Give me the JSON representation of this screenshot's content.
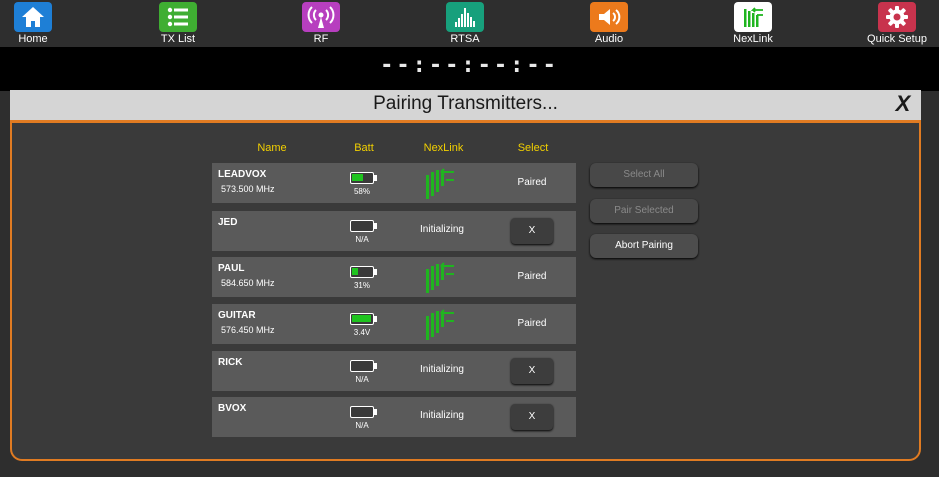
{
  "nav": [
    {
      "label": "Home",
      "icon": "home-icon",
      "color": "#1e7fd6"
    },
    {
      "label": "TX List",
      "icon": "list-icon",
      "color": "#3fae32"
    },
    {
      "label": "RF",
      "icon": "antenna-icon",
      "color": "#b73fbf"
    },
    {
      "label": "RTSA",
      "icon": "spectrum-icon",
      "color": "#17a07c"
    },
    {
      "label": "Audio",
      "icon": "speaker-icon",
      "color": "#ec7a1c"
    },
    {
      "label": "NexLink",
      "icon": "nexlink-icon",
      "color": "#ffffff"
    },
    {
      "label": "Quick Setup",
      "icon": "gear-icon",
      "color": "#c8334d"
    }
  ],
  "time_display": "--:--:--:--",
  "dialog": {
    "title": "Pairing Transmitters...",
    "close_label": "X",
    "columns": {
      "name": "Name",
      "batt": "Batt",
      "nexlink": "NexLink",
      "select": "Select"
    },
    "rows": [
      {
        "name": "LEADVOX",
        "freq": "573.500 MHz",
        "batt_text": "58%",
        "batt_level": 0.58,
        "nexlink": true,
        "status": "",
        "select": "Paired"
      },
      {
        "name": "JED",
        "freq": "",
        "batt_text": "N/A",
        "batt_level": 0,
        "nexlink": false,
        "status": "Initializing",
        "select": "X"
      },
      {
        "name": "PAUL",
        "freq": "584.650 MHz",
        "batt_text": "31%",
        "batt_level": 0.31,
        "nexlink": true,
        "status": "",
        "select": "Paired"
      },
      {
        "name": "GUITAR",
        "freq": "576.450 MHz",
        "batt_text": "3.4V",
        "batt_level": 1.0,
        "nexlink": true,
        "status": "",
        "select": "Paired"
      },
      {
        "name": "RICK",
        "freq": "",
        "batt_text": "N/A",
        "batt_level": 0,
        "nexlink": false,
        "status": "Initializing",
        "select": "X"
      },
      {
        "name": "BVOX",
        "freq": "",
        "batt_text": "N/A",
        "batt_level": 0,
        "nexlink": false,
        "status": "Initializing",
        "select": "X"
      }
    ],
    "buttons": {
      "select_all": "Select All",
      "pair_selected": "Pair Selected",
      "abort_pairing": "Abort Pairing"
    }
  },
  "colors": {
    "accent": "#e07b22",
    "header_text": "#f2d000",
    "battery_green": "#1fc41f"
  }
}
